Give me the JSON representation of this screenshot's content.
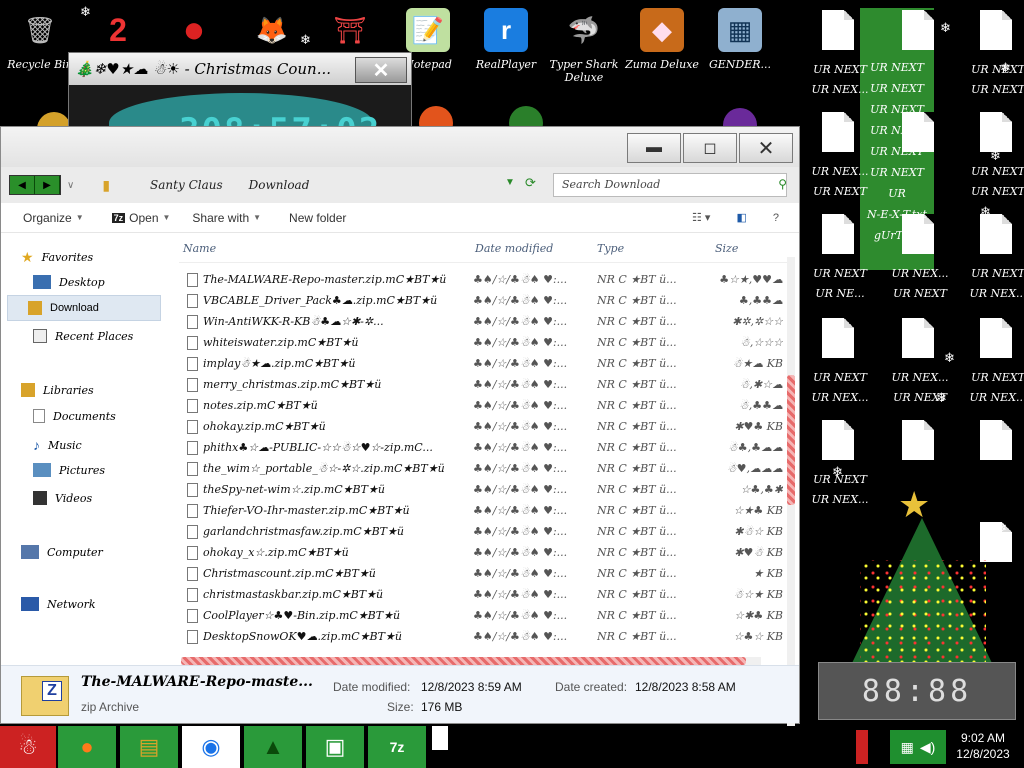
{
  "desktop": {
    "icons": [
      {
        "id": "recycle",
        "label": "Recycle Bin",
        "glyph": "🗑"
      },
      {
        "id": "q2",
        "label": "",
        "glyph": "2"
      },
      {
        "id": "red",
        "label": "",
        "glyph": "●"
      },
      {
        "id": "firefox",
        "label": "",
        "glyph": "🦊"
      },
      {
        "id": "gate",
        "label": "",
        "glyph": "⛩"
      },
      {
        "id": "notepad",
        "label": "Notepad",
        "glyph": "📝"
      },
      {
        "id": "realplayer",
        "label": "RealPlayer",
        "glyph": "r"
      },
      {
        "id": "typershark",
        "label": "Typer Shark Deluxe",
        "glyph": "🦈"
      },
      {
        "id": "zuma",
        "label": "Zuma Deluxe",
        "glyph": "◆"
      },
      {
        "id": "gender",
        "label": "GENDER...",
        "glyph": "▦"
      }
    ],
    "doc_labels": [
      "UR NEXT",
      "UR NEX...",
      "UR NEXT",
      "UR NEXT",
      "UR NEX...",
      "UR NEXT",
      "UR NEXT",
      "UR NEXT",
      "UR NEXT",
      "UR NE...",
      "UR NEX...",
      "UR NEXT",
      "UR NEXT",
      "UR NEX...",
      "UR NEXT",
      "UR NEX...",
      "UR NEX...",
      "UR NEXT",
      "UR NEXT",
      "UR NEX...",
      "UR NEXT",
      "UR NEX..."
    ],
    "highlight_labels": [
      "UR NEXT",
      "UR NEXT",
      "UR NEXT",
      "UR NEXT",
      "UR NEXT",
      "UR NEXT",
      "UR",
      "N-E-X-T.txt",
      "gUrTxte"
    ]
  },
  "countdown": {
    "title": "🎄❄♥★☁ ☃☀ - Christmas Coun...",
    "close_glyph": "✕",
    "time": "308:57:02"
  },
  "explorer": {
    "crumbs": [
      "Santy Claus",
      "Download"
    ],
    "search_placeholder": "Search Download",
    "toolbar": {
      "organize": "Organize",
      "open": "Open",
      "share": "Share with",
      "newfolder": "New folder"
    },
    "nav": {
      "favorites": "Favorites",
      "desktop": "Desktop",
      "download": "Download",
      "recent": "Recent Places",
      "libraries": "Libraries",
      "documents": "Documents",
      "music": "Music",
      "pictures": "Pictures",
      "videos": "Videos",
      "computer": "Computer",
      "network": "Network"
    },
    "columns": {
      "name": "Name",
      "date": "Date modified",
      "type": "Type",
      "size": "Size"
    },
    "files": [
      {
        "name": "The-MALWARE-Repo-master.zip.mC★BT★ü",
        "date": "♣♠/☆/♣☃♠ ♥:...",
        "type": "NR C ★BT ü...",
        "size": "♣☆★,♥♥☁"
      },
      {
        "name": "VBCABLE_Driver_Pack♣☁.zip.mC★BT★ü",
        "date": "♣♠/☆/♣☃♠ ♥:...",
        "type": "NR C ★BT ü...",
        "size": "♣,♣♣☁"
      },
      {
        "name": "Win-AntiWKK-R-KB☃♣☁☆✱-✲...",
        "date": "♣♠/☆/♣☃♠ ♥:...",
        "type": "NR C ★BT ü...",
        "size": "✱✲,✲☆☆"
      },
      {
        "name": "whiteiswater.zip.mC★BT★ü",
        "date": "♣♠/☆/♣☃♠ ♥:...",
        "type": "NR C ★BT ü...",
        "size": "☃,☆☆☆"
      },
      {
        "name": "implay☃★☁.zip.mC★BT★ü",
        "date": "♣♠/☆/♣☃♠ ♥:...",
        "type": "NR C ★BT ü...",
        "size": "☃★☁ KB"
      },
      {
        "name": "merry_christmas.zip.mC★BT★ü",
        "date": "♣♠/☆/♣☃♠ ♥:...",
        "type": "NR C ★BT ü...",
        "size": "☃,✱☆☁"
      },
      {
        "name": "notes.zip.mC★BT★ü",
        "date": "♣♠/☆/♣☃♠ ♥:...",
        "type": "NR C ★BT ü...",
        "size": "☃,♣♣☁"
      },
      {
        "name": "ohokay.zip.mC★BT★ü",
        "date": "♣♠/☆/♣☃♠ ♥:...",
        "type": "NR C ★BT ü...",
        "size": "✱♥♣ KB"
      },
      {
        "name": "phithx♣☆☁-PUBLIC-☆☆☃☆♥☆-zip.mC...",
        "date": "♣♠/☆/♣☃♠ ♥:...",
        "type": "NR C ★BT ü...",
        "size": "☃♣,♣☁☁"
      },
      {
        "name": "the_wim☆_portable_☃☆-✲☆.zip.mC★BT★ü",
        "date": "♣♠/☆/♣☃♠ ♥:...",
        "type": "NR C ★BT ü...",
        "size": "☃♥,☁☁☁"
      },
      {
        "name": "theSpy-net-wim☆.zip.mC★BT★ü",
        "date": "♣♠/☆/♣☃♠ ♥:...",
        "type": "NR C ★BT ü...",
        "size": "☆♣,♣✱"
      },
      {
        "name": "Thiefer-VO-Ihr-master.zip.mC★BT★ü",
        "date": "♣♠/☆/♣☃♠ ♥:...",
        "type": "NR C ★BT ü...",
        "size": "☆★♣ KB"
      },
      {
        "name": "garlandchristmasfaw.zip.mC★BT★ü",
        "date": "♣♠/☆/♣☃♠ ♥:...",
        "type": "NR C ★BT ü...",
        "size": "✱☃☆ KB"
      },
      {
        "name": "ohokay_x☆.zip.mC★BT★ü",
        "date": "♣♠/☆/♣☃♠ ♥:...",
        "type": "NR C ★BT ü...",
        "size": "✱♥☃ KB"
      },
      {
        "name": "Christmascount.zip.mC★BT★ü",
        "date": "♣♠/☆/♣☃♠ ♥:...",
        "type": "NR C ★BT ü...",
        "size": "★ KB"
      },
      {
        "name": "christmastaskbar.zip.mC★BT★ü",
        "date": "♣♠/☆/♣☃♠ ♥:...",
        "type": "NR C ★BT ü...",
        "size": "☃☆★ KB"
      },
      {
        "name": "CoolPlayer☆♣♥-Bin.zip.mC★BT★ü",
        "date": "♣♠/☆/♣☃♠ ♥:...",
        "type": "NR C ★BT ü...",
        "size": "☆✱♣ KB"
      },
      {
        "name": "DesktopSnowOK♥☁.zip.mC★BT★ü",
        "date": "♣♠/☆/♣☃♠ ♥:...",
        "type": "NR C ★BT ü...",
        "size": "☆♣☆ KB"
      }
    ],
    "details": {
      "filename": "The-MALWARE-Repo-maste...",
      "filetype": "zip Archive",
      "date_modified_label": "Date modified:",
      "date_modified": "12/8/2023 8:59 AM",
      "date_created_label": "Date created:",
      "date_created": "12/8/2023 8:58 AM",
      "size_label": "Size:",
      "size": "176 MB"
    }
  },
  "clockwidget": {
    "text": "88:88"
  },
  "taskbar": {
    "apps": [
      "santa",
      "firefox",
      "explorer",
      "chrome",
      "tree",
      "photos",
      "7zip"
    ],
    "time": "9:02 AM",
    "date": "12/8/2023"
  }
}
